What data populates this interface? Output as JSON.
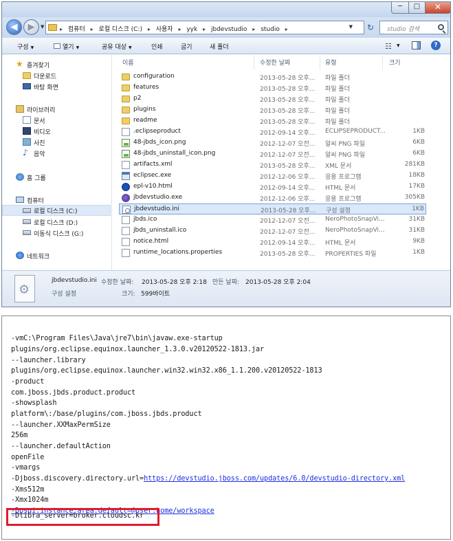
{
  "explorer": {
    "window_buttons": {
      "minimize": "─",
      "maximize": "□",
      "close": "✕"
    },
    "nav": {
      "back": "◀",
      "forward": "▶",
      "refresh": "↻"
    },
    "breadcrumbs": [
      "컴퓨터",
      "로컬 디스크 (C:)",
      "사용자",
      "yyk",
      "jbdevstudio",
      "studio"
    ],
    "search_placeholder": "studio 검색",
    "toolbar": [
      "구성",
      "열기",
      "공유 대상",
      "인쇄",
      "굽기",
      "새 폴더"
    ],
    "sidebar": {
      "favorites": {
        "label": "즐겨찾기",
        "items": [
          "다운로드",
          "바탕 화면"
        ]
      },
      "libraries": {
        "label": "라이브러리",
        "items": [
          "문서",
          "비디오",
          "사진",
          "음악"
        ]
      },
      "homegroup": "홈 그룹",
      "computer": {
        "label": "컴퓨터",
        "items": [
          "로컬 디스크 (C:)",
          "로컬 디스크 (D:)",
          "이동식 디스크 (G:)"
        ]
      },
      "network": "네트워크"
    },
    "columns": [
      "이름",
      "수정한 날짜",
      "유형",
      "크기"
    ],
    "files": [
      {
        "name": "configuration",
        "date": "2013-05-28 오후...",
        "type": "파일 폴더",
        "size": "",
        "icon": "folder-icon"
      },
      {
        "name": "features",
        "date": "2013-05-28 오후...",
        "type": "파일 폴더",
        "size": "",
        "icon": "folder-icon"
      },
      {
        "name": "p2",
        "date": "2013-05-28 오후...",
        "type": "파일 폴더",
        "size": "",
        "icon": "folder-icon"
      },
      {
        "name": "plugins",
        "date": "2013-05-28 오후...",
        "type": "파일 폴더",
        "size": "",
        "icon": "folder-icon"
      },
      {
        "name": "readme",
        "date": "2013-05-28 오후...",
        "type": "파일 폴더",
        "size": "",
        "icon": "folder-icon"
      },
      {
        "name": ".eclipseproduct",
        "date": "2012-09-14 오후...",
        "type": "ECLIPSEPRODUCT...",
        "size": "1KB",
        "icon": "file-icon"
      },
      {
        "name": "48-jbds_icon.png",
        "date": "2012-12-07 오전...",
        "type": "알씨 PNG 파일",
        "size": "6KB",
        "icon": "png-icon"
      },
      {
        "name": "48-jbds_uninstall_icon.png",
        "date": "2012-12-07 오전...",
        "type": "알씨 PNG 파일",
        "size": "6KB",
        "icon": "png-icon"
      },
      {
        "name": "artifacts.xml",
        "date": "2013-05-28 오후...",
        "type": "XML 문서",
        "size": "281KB",
        "icon": "file-icon"
      },
      {
        "name": "eclipsec.exe",
        "date": "2012-12-06 오후...",
        "type": "응용 프로그램",
        "size": "18KB",
        "icon": "exe-icon"
      },
      {
        "name": "epl-v10.html",
        "date": "2012-09-14 오후...",
        "type": "HTML 문서",
        "size": "17KB",
        "icon": "html-icon"
      },
      {
        "name": "jbdevstudio.exe",
        "date": "2012-12-06 오후...",
        "type": "응용 프로그램",
        "size": "305KB",
        "icon": "eclipse-icon"
      },
      {
        "name": "jbdevstudio.ini",
        "date": "2013-05-28 오후...",
        "type": "구성 설정",
        "size": "1KB",
        "icon": "ini-icon",
        "selected": true
      },
      {
        "name": "jbds.ico",
        "date": "2012-12-07 오전...",
        "type": "NeroPhotoSnapVi...",
        "size": "31KB",
        "icon": "file-icon"
      },
      {
        "name": "jbds_uninstall.ico",
        "date": "2012-12-07 오전...",
        "type": "NeroPhotoSnapVi...",
        "size": "31KB",
        "icon": "file-icon"
      },
      {
        "name": "notice.html",
        "date": "2012-09-14 오후...",
        "type": "HTML 문서",
        "size": "9KB",
        "icon": "file-icon"
      },
      {
        "name": "runtime_locations.properties",
        "date": "2013-05-28 오후...",
        "type": "PROPERTIES 파일",
        "size": "1KB",
        "icon": "file-icon"
      }
    ],
    "details": {
      "filename": "jbdevstudio.ini",
      "modified_label": "수정한 날짜:",
      "modified_value": "2013-05-28 오후 2:18",
      "created_label": "만든 날짜:",
      "created_value": "2013-05-28 오후 2:04",
      "type": "구성 설정",
      "size_label": "크기:",
      "size_value": "599바이트"
    }
  },
  "ini_file": {
    "lines": [
      "-vmC:\\Program Files\\Java\\jre7\\bin\\javaw.exe-startup",
      "plugins/org.eclipse.equinox.launcher_1.3.0.v20120522-1813.jar",
      "--launcher.library",
      "plugins/org.eclipse.equinox.launcher.win32.win32.x86_1.1.200.v20120522-1813",
      "-product",
      "com.jboss.jbds.product.product",
      "-showsplash",
      "platform\\:/base/plugins/com.jboss.jbds.product",
      "--launcher.XXMaxPermSize",
      "256m",
      "--launcher.defaultAction",
      "openFile",
      "-vmargs",
      "-Djboss.discovery.directory.url=",
      "-Xms512m",
      "-Xmx1024m",
      "-Dosgi.instance.area.default=@user.home/workspace",
      "-Dlibra_server=broker.cloudsc.kr"
    ],
    "link_url": "https://devstudio.jboss.com/updates/6.0/devstudio-directory.xml",
    "highlight_color": "#e11b2b"
  }
}
